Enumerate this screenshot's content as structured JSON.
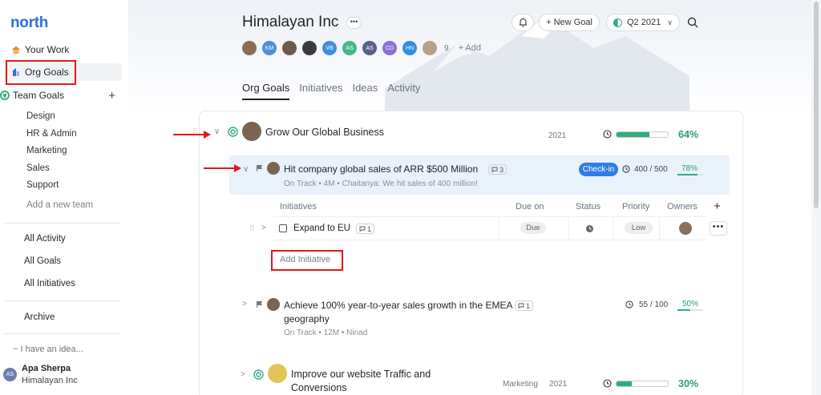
{
  "sidebar": {
    "logo": "north",
    "nav": [
      {
        "label": "Your Work"
      },
      {
        "label": "Org Goals"
      }
    ],
    "team_goals": {
      "label": "Team Goals",
      "plus": "+",
      "teams": [
        "Design",
        "HR & Admin",
        "Marketing",
        "Sales",
        "Support"
      ],
      "add_team": "Add a new team"
    },
    "links": [
      "All Activity",
      "All Goals",
      "All Initiatives"
    ],
    "archive": "Archive",
    "idea": "~ I have an idea...",
    "user": {
      "initials": "AS",
      "name": "Apa Sherpa",
      "org": "Himalayan Inc"
    }
  },
  "header": {
    "title": "Himalayan Inc",
    "more": "•••",
    "new_goal": "+ New Goal",
    "quarter": "Q2 2021",
    "avatars": [
      {
        "initials": "",
        "color": "#8a6f5a"
      },
      {
        "initials": "KM",
        "color": "#4f8fd8"
      },
      {
        "initials": "",
        "color": "#6e5a48"
      },
      {
        "initials": "",
        "color": "#3c3c3c"
      },
      {
        "initials": "VB",
        "color": "#3f8fe0"
      },
      {
        "initials": "AS",
        "color": "#45b88c"
      },
      {
        "initials": "AS",
        "color": "#5a5f8c"
      },
      {
        "initials": "CD",
        "color": "#8c6fd8"
      },
      {
        "initials": "HN",
        "color": "#2f8fe6"
      },
      {
        "initials": "",
        "color": "#b8a08a"
      }
    ],
    "member_count": "9",
    "add": "+ Add",
    "tabs": [
      "Org Goals",
      "Initiatives",
      "Ideas",
      "Activity"
    ]
  },
  "goals": {
    "goal1": {
      "title": "Grow Our Global Business",
      "year": "2021",
      "progress": 64,
      "pct": "64%"
    },
    "kr1": {
      "title": "Hit company global sales of ARR $500 Million",
      "comments": "3",
      "status": "On Track",
      "age": "4M",
      "note": "Chaitanya: We hit sales of 400 million!",
      "checkin": "Check-in",
      "value": "400 / 500",
      "progress": 78,
      "pct": "78%"
    },
    "initiatives_table": {
      "headers": [
        "Initiatives",
        "Due on",
        "Status",
        "Priority",
        "Owners"
      ],
      "plus": "+",
      "rows": [
        {
          "name": "Expand to EU",
          "comments": "1",
          "due": "Due",
          "priority": "Low"
        }
      ],
      "add_initiative": "Add Initiative",
      "more": "•••"
    },
    "kr2": {
      "title": "Achieve 100% year-to-year sales growth in the EMEA",
      "title2": "geography",
      "comments": "1",
      "status": "On Track",
      "age": "12M",
      "owner": "Ninad",
      "value": "55 / 100",
      "progress": 50,
      "pct": "50%"
    },
    "goal2": {
      "title": "Improve our website Traffic and",
      "title2": "Conversions",
      "team": "Marketing",
      "year": "2021",
      "progress": 30,
      "pct": "30%"
    }
  },
  "colors": {
    "accent": "#2f6fe4",
    "progress": "#2fae7a",
    "highlight": "#e11919"
  }
}
